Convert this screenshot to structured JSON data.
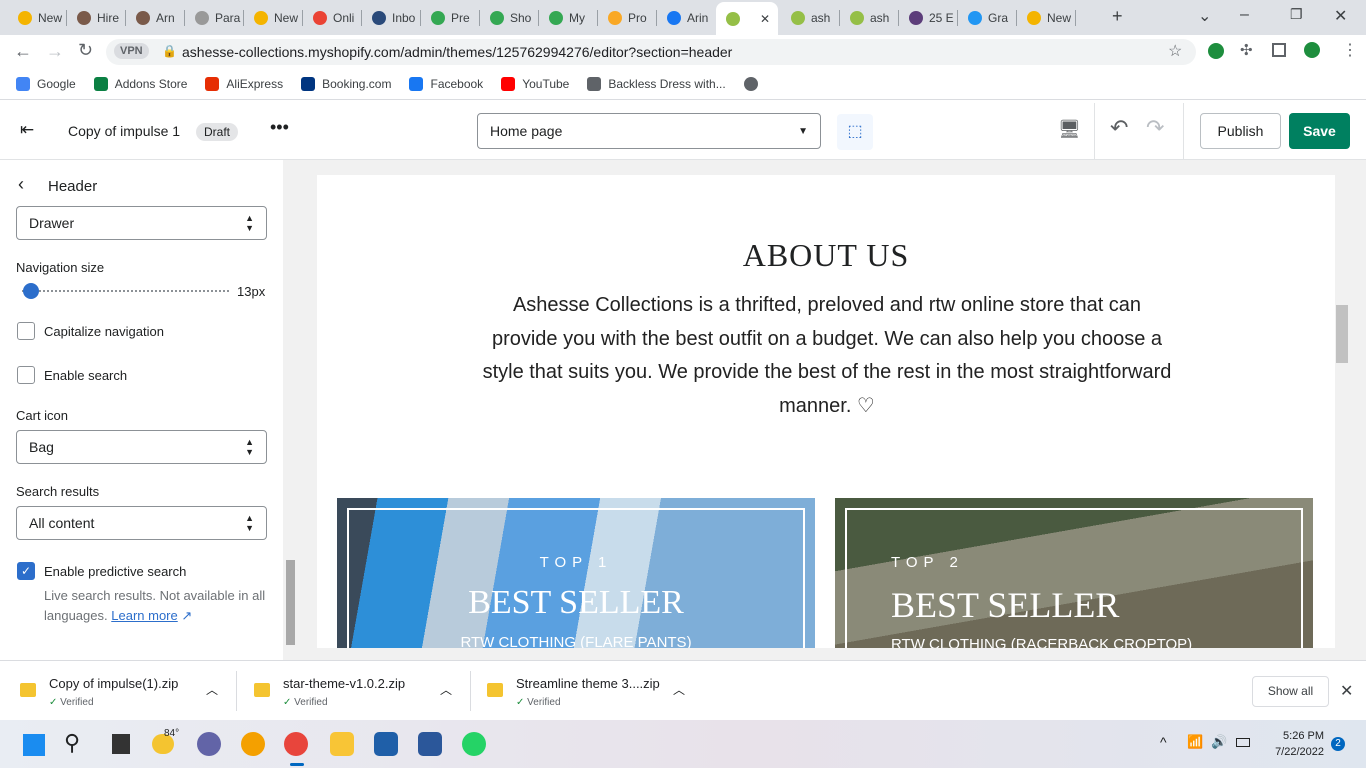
{
  "browser": {
    "tabs": [
      {
        "label": "New",
        "color": "#f4b400"
      },
      {
        "label": "Hire",
        "color": "#7a5a4a"
      },
      {
        "label": "Arn",
        "color": "#7a5a4a"
      },
      {
        "label": "Para",
        "color": "#999999"
      },
      {
        "label": "New",
        "color": "#f4b400"
      },
      {
        "label": "Onli",
        "color": "#ea4335"
      },
      {
        "label": "Inbo",
        "color": "#2a4a7a"
      },
      {
        "label": "Pre",
        "color": "#34a853"
      },
      {
        "label": "Sho",
        "color": "#34a853"
      },
      {
        "label": "My",
        "color": "#34a853"
      },
      {
        "label": "Pro",
        "color": "#f9a825"
      },
      {
        "label": "Arin",
        "color": "#1877f2"
      },
      {
        "label": "",
        "color": "#95bf47"
      },
      {
        "label": "ash",
        "color": "#95bf47"
      },
      {
        "label": "ash",
        "color": "#95bf47"
      },
      {
        "label": "25 E",
        "color": "#5c3d7a"
      },
      {
        "label": "Gra",
        "color": "#2196f3"
      },
      {
        "label": "New",
        "color": "#f4b400"
      }
    ],
    "url": "ashesse-collections.myshopify.com/admin/themes/125762994276/editor?section=header",
    "vpn": "VPN",
    "bookmarks": [
      {
        "label": "Google",
        "color": "#4285f4"
      },
      {
        "label": "Addons Store",
        "color": "#0b8043"
      },
      {
        "label": "AliExpress",
        "color": "#e62e04"
      },
      {
        "label": "Booking.com",
        "color": "#003580"
      },
      {
        "label": "Facebook",
        "color": "#1877f2"
      },
      {
        "label": "YouTube",
        "color": "#ff0000"
      },
      {
        "label": "Backless Dress with...",
        "color": "#5f6368"
      }
    ]
  },
  "editor": {
    "theme_name": "Copy of impulse 1",
    "status": "Draft",
    "page_select": "Home page",
    "publish": "Publish",
    "save": "Save"
  },
  "sidebar": {
    "title": "Header",
    "drawer_select": "Drawer",
    "nav_size_label": "Navigation size",
    "nav_size_value": "13px",
    "nav_size_fraction": 0.05,
    "capitalize": "Capitalize navigation",
    "enable_search": "Enable search",
    "cart_icon_label": "Cart icon",
    "cart_icon_value": "Bag",
    "search_results_label": "Search results",
    "search_results_value": "All content",
    "predictive": "Enable predictive search",
    "predictive_help": "Live search results. Not available in all languages.",
    "learn_more": "Learn more"
  },
  "preview": {
    "about_title": "ABOUT US",
    "about_text": "Ashesse Collections is a thrifted, preloved and rtw online store that can provide you with the best outfit on a budget. We can also help you choose a style that suits you. We provide the best of the rest in the most straightforward manner. ♡",
    "cards": [
      {
        "kicker": "TOP 1",
        "title": "BEST SELLER",
        "sub": "RTW CLOTHING (FLARE PANTS)"
      },
      {
        "kicker": "TOP 2",
        "title": "BEST SELLER",
        "sub": "RTW CLOTHING (RACERBACK CROPTOP)"
      }
    ]
  },
  "downloads": {
    "items": [
      {
        "name": "Copy of impulse(1).zip",
        "status": "Verified"
      },
      {
        "name": "star-theme-v1.0.2.zip",
        "status": "Verified"
      },
      {
        "name": "Streamline theme 3....zip",
        "status": "Verified"
      }
    ],
    "show_all": "Show all"
  },
  "taskbar": {
    "weather": "84°",
    "time": "5:26 PM",
    "date": "7/22/2022",
    "notifications": "2"
  }
}
